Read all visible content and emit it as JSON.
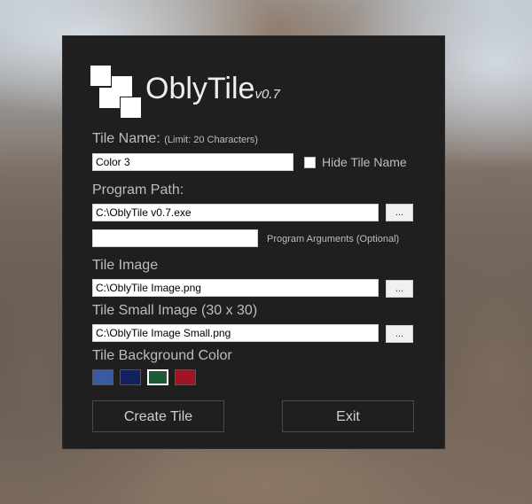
{
  "app": {
    "name": "OblyTile",
    "version": "v0.7"
  },
  "tile_name": {
    "label": "Tile Name:",
    "limit_note": "(Limit: 20 Characters)",
    "value": "Color 3",
    "hide_label": "Hide Tile Name"
  },
  "program_path": {
    "label": "Program Path:",
    "value": "C:\\OblyTile v0.7.exe",
    "browse_label": "...",
    "args_value": "",
    "args_label": "Program Arguments (Optional)"
  },
  "tile_image": {
    "label": "Tile Image",
    "value": "C:\\OblyTile Image.png",
    "browse_label": "..."
  },
  "tile_small_image": {
    "label": "Tile Small Image (30 x 30)",
    "value": "C:\\OblyTile Image Small.png",
    "browse_label": "..."
  },
  "background_color": {
    "label": "Tile Background Color",
    "swatches": [
      "#3a5ba0",
      "#102060",
      "#1f5a35",
      "#a01423"
    ],
    "selected_index": 2
  },
  "buttons": {
    "create": "Create Tile",
    "exit": "Exit"
  }
}
